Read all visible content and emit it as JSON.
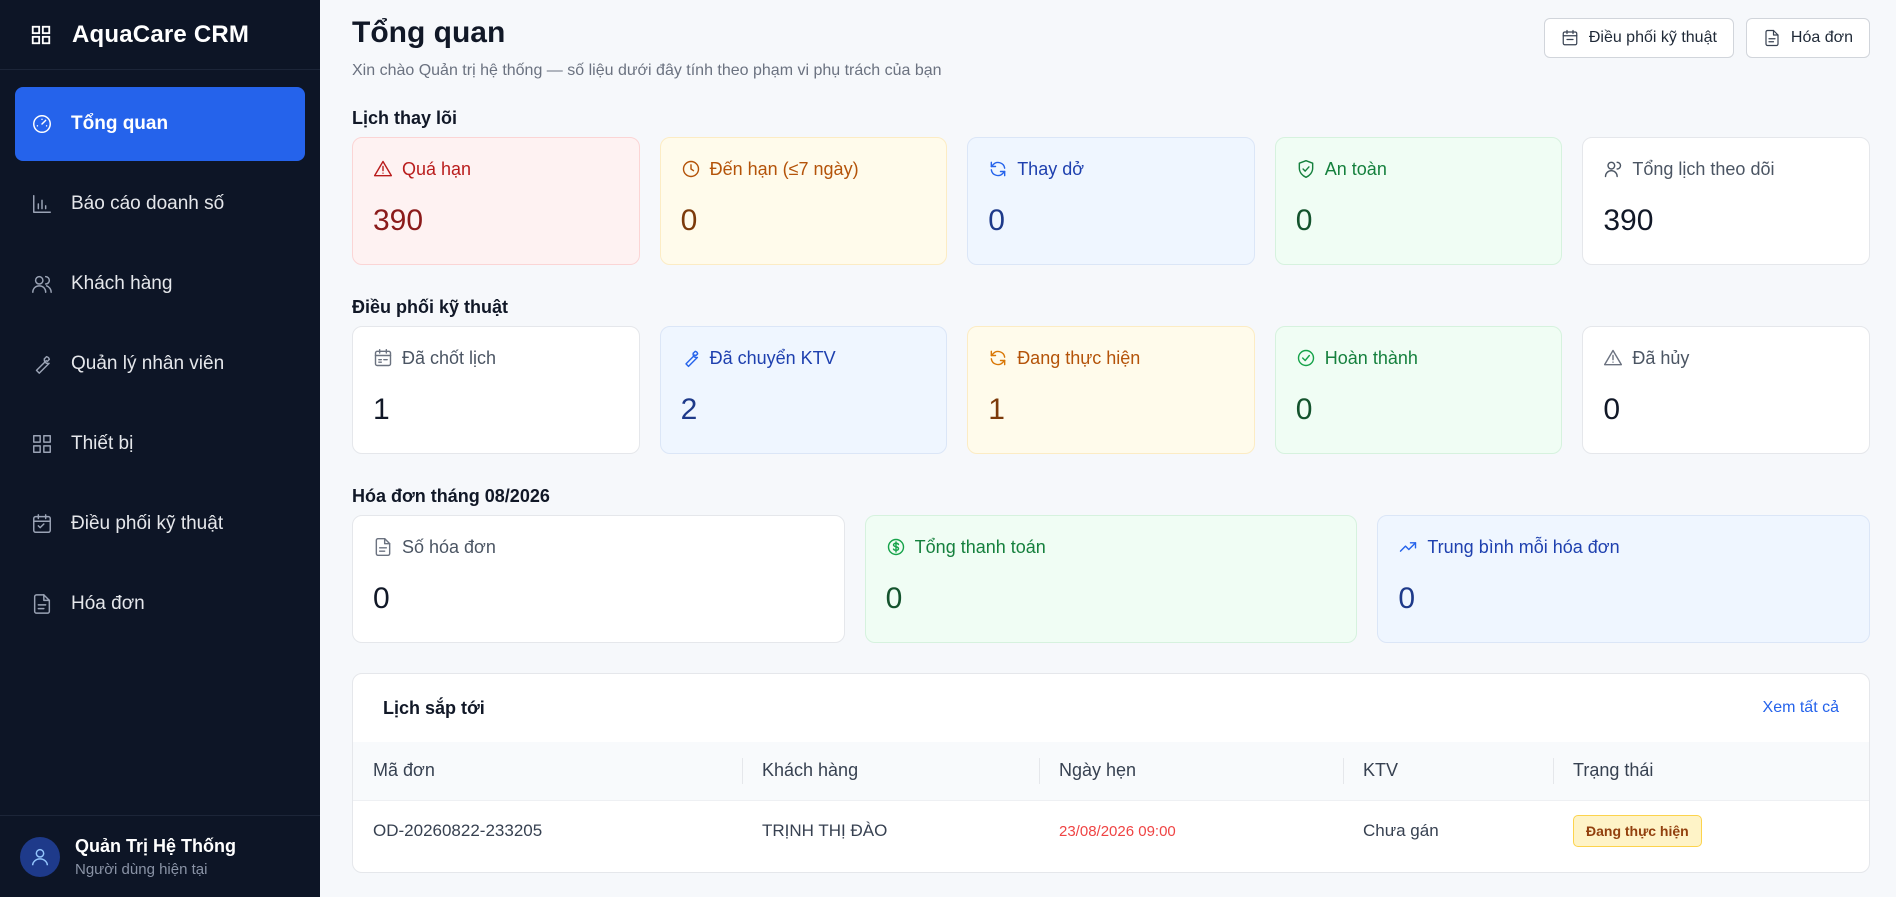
{
  "app": {
    "name": "AquaCare CRM"
  },
  "sidebar": {
    "items": [
      {
        "label": "Tổng quan",
        "icon": "dashboard-icon",
        "active": true
      },
      {
        "label": "Báo cáo doanh số",
        "icon": "bar-chart-icon"
      },
      {
        "label": "Khách hàng",
        "icon": "users-icon"
      },
      {
        "label": "Quản lý nhân viên",
        "icon": "wrench-icon"
      },
      {
        "label": "Thiết bị",
        "icon": "grid-icon"
      },
      {
        "label": "Điều phối kỹ thuật",
        "icon": "calendar-icon"
      },
      {
        "label": "Hóa đơn",
        "icon": "document-icon"
      }
    ],
    "user": {
      "name": "Quản Trị Hệ Thống",
      "role": "Người dùng hiện tại"
    }
  },
  "header": {
    "title": "Tổng quan",
    "subtitle": "Xin chào Quản trị hệ thống — số liệu dưới đây tính theo phạm vi phụ trách của bạn",
    "buttons": {
      "dispatch": "Điều phối kỹ thuật",
      "invoice": "Hóa đơn"
    }
  },
  "filters": {
    "title": "Lịch thay lõi",
    "cards": [
      {
        "label": "Quá hạn",
        "value": "390",
        "color": "#b91c1c"
      },
      {
        "label": "Đến hạn (≤7 ngày)",
        "value": "0",
        "color": "#b45309"
      },
      {
        "label": "Thay dở",
        "value": "0",
        "color": "#1e40af"
      },
      {
        "label": "An toàn",
        "value": "0",
        "color": "#15803d"
      },
      {
        "label": "Tổng lịch theo dõi",
        "value": "390",
        "color": "#4b5563"
      }
    ]
  },
  "dispatch": {
    "title": "Điều phối kỹ thuật",
    "cards": [
      {
        "label": "Đã chốt lịch",
        "value": "1"
      },
      {
        "label": "Đã chuyển KTV",
        "value": "2"
      },
      {
        "label": "Đang thực hiện",
        "value": "1"
      },
      {
        "label": "Hoàn thành",
        "value": "0"
      },
      {
        "label": "Đã hủy",
        "value": "0"
      }
    ]
  },
  "invoices": {
    "title": "Hóa đơn tháng 08/2026",
    "cards": [
      {
        "label": "Số hóa đơn",
        "value": "0"
      },
      {
        "label": "Tổng thanh toán",
        "value": "0"
      },
      {
        "label": "Trung bình mỗi hóa đơn",
        "value": "0"
      }
    ]
  },
  "upcoming": {
    "title": "Lịch sắp tới",
    "view_all": "Xem tất cả",
    "columns": [
      "Mã đơn",
      "Khách hàng",
      "Ngày hẹn",
      "KTV",
      "Trạng thái"
    ],
    "rows": [
      {
        "code": "OD-20260822-233205",
        "customer": "TRỊNH THỊ ĐÀO",
        "date": "23/08/2026 09:00",
        "tech": "Chưa gán",
        "status": "Đang thực hiện"
      }
    ]
  }
}
